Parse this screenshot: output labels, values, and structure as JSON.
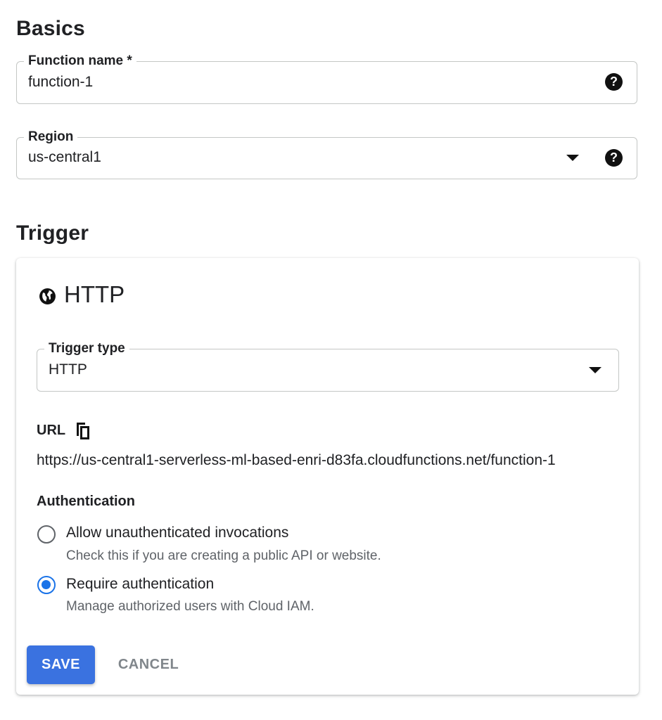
{
  "basics": {
    "title": "Basics",
    "function_name": {
      "label": "Function name *",
      "value": "function-1",
      "help_icon": "help-circle-icon"
    },
    "region": {
      "label": "Region",
      "value": "us-central1",
      "help_icon": "help-circle-icon"
    }
  },
  "trigger": {
    "title": "Trigger",
    "card": {
      "icon": "globe-icon",
      "title": "HTTP",
      "trigger_type": {
        "label": "Trigger type",
        "value": "HTTP"
      },
      "url": {
        "label": "URL",
        "copy_icon": "copy-icon",
        "value": "https://us-central1-serverless-ml-based-enri-d83fa.cloudfunctions.net/function-1"
      },
      "authentication": {
        "label": "Authentication",
        "options": [
          {
            "label": "Allow unauthenticated invocations",
            "description": "Check this if you are creating a public API or website.",
            "selected": false
          },
          {
            "label": "Require authentication",
            "description": "Manage authorized users with Cloud IAM.",
            "selected": true
          }
        ]
      },
      "actions": {
        "save_label": "SAVE",
        "cancel_label": "CANCEL"
      }
    }
  },
  "colors": {
    "accent": "#1a73e8",
    "save_button": "#3a72e0",
    "secondary_text": "#5f6368",
    "cancel_text": "#80868b"
  }
}
